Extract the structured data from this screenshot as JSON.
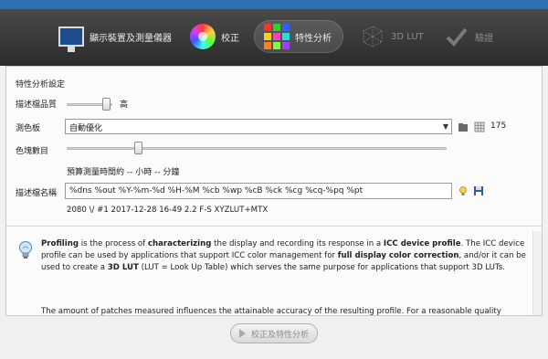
{
  "toolbar": {
    "items": [
      {
        "label": "顯示裝置及測量儀器",
        "icon": "monitor-icon"
      },
      {
        "label": "校正",
        "icon": "color-wheel-icon"
      },
      {
        "label": "特性分析",
        "icon": "color-grid-icon",
        "active": true
      },
      {
        "label": "3D LUT",
        "icon": "lut-icon",
        "disabled": true
      },
      {
        "label": "驗證",
        "icon": "checkmark-icon",
        "disabled": true
      }
    ]
  },
  "profiling": {
    "section_title": "特性分析設定",
    "quality_label": "描述檔品質",
    "quality_value": "高",
    "testchart_label": "測色板",
    "testchart_value": "自動優化",
    "patch_count": "175",
    "patch_amount_label": "色塊數目",
    "time_estimate": "預算測量時間約 -- 小時 -- 分鐘",
    "profile_name_label": "描述檔名稱",
    "profile_name_value": "%dns %out %Y-%m-%d %H-%M %cb %wp %cB %ck %cg %cq-%pq %pt",
    "profile_name_preview": "2080 \\/ #1 2017-12-28 16-49 2.2 F-S XYZLUT+MTX"
  },
  "info": {
    "p1_a": "Profiling",
    "p1_b": " is the process of ",
    "p1_c": "characterizing",
    "p1_d": " the display and recording its response in a ",
    "p1_e": "ICC device profile",
    "p1_f": ". The ICC device profile can be used by applications that support ICC color management for ",
    "p1_g": "full display color correction",
    "p1_h": ", and/or it can be used to create a ",
    "p1_i": "3D LUT",
    "p1_j": " (LUT = Look Up Table) which serves the same purpose for applications that support 3D LUTs.",
    "p2": "The amount of patches measured influences the attainable accuracy of the resulting profile. For a reasonable quality"
  },
  "bottom": {
    "button_label": "校正及特性分析"
  }
}
